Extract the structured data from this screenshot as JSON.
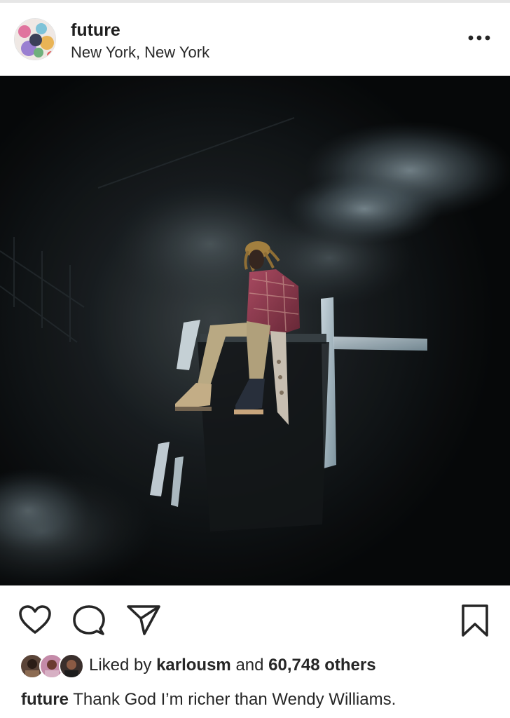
{
  "post": {
    "username": "future",
    "location": "New York, New York",
    "more_icon": "more-horizontal-icon",
    "photo_alt": "",
    "actions": {
      "like_icon": "heart-icon",
      "comment_icon": "comment-icon",
      "share_icon": "paper-plane-icon",
      "save_icon": "bookmark-icon"
    },
    "likes": {
      "prefix": "Liked by",
      "user": "karlousm",
      "connector": "and",
      "count": "60,748 others"
    },
    "caption": {
      "username": "future",
      "text": "Thank God I’m richer than Wendy Williams."
    }
  },
  "colors": {
    "text": "#262626",
    "divider": "#e6e6e6",
    "background": "#ffffff"
  }
}
